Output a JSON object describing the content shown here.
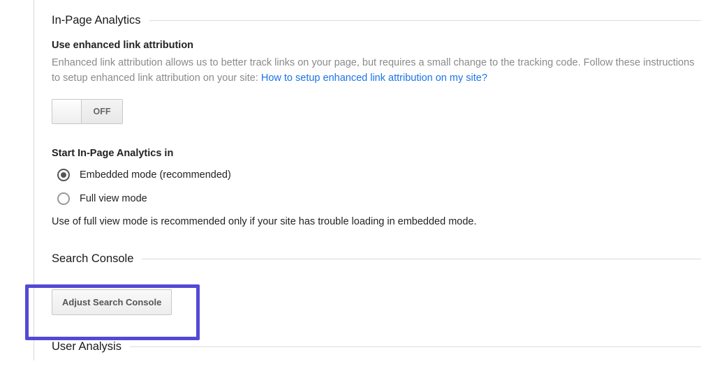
{
  "sections": {
    "inpage": {
      "title": "In-Page Analytics",
      "enhanced": {
        "label": "Use enhanced link attribution",
        "description": "Enhanced link attribution allows us to better track links on your page, but requires a small change to the tracking code. Follow these instructions to setup enhanced link attribution on your site: ",
        "link_text": "How to setup enhanced link attribution on my site?",
        "toggle_state": "OFF"
      },
      "startin": {
        "label": "Start In-Page Analytics in",
        "options": {
          "embedded": "Embedded mode (recommended)",
          "fullview": "Full view mode"
        },
        "helper": "Use of full view mode is recommended only if your site has trouble loading in embedded mode."
      }
    },
    "searchconsole": {
      "title": "Search Console",
      "button_label": "Adjust Search Console"
    },
    "useranalysis": {
      "title": "User Analysis"
    }
  }
}
